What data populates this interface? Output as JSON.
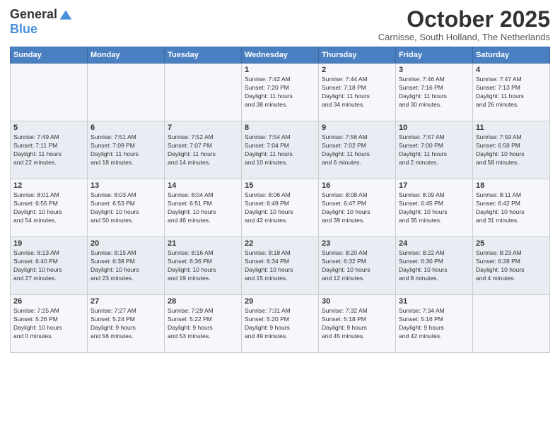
{
  "logo": {
    "general": "General",
    "blue": "Blue"
  },
  "header": {
    "month": "October 2025",
    "location": "Carnisse, South Holland, The Netherlands"
  },
  "weekdays": [
    "Sunday",
    "Monday",
    "Tuesday",
    "Wednesday",
    "Thursday",
    "Friday",
    "Saturday"
  ],
  "weeks": [
    [
      {
        "day": "",
        "info": ""
      },
      {
        "day": "",
        "info": ""
      },
      {
        "day": "",
        "info": ""
      },
      {
        "day": "1",
        "info": "Sunrise: 7:42 AM\nSunset: 7:20 PM\nDaylight: 11 hours\nand 38 minutes."
      },
      {
        "day": "2",
        "info": "Sunrise: 7:44 AM\nSunset: 7:18 PM\nDaylight: 11 hours\nand 34 minutes."
      },
      {
        "day": "3",
        "info": "Sunrise: 7:46 AM\nSunset: 7:16 PM\nDaylight: 11 hours\nand 30 minutes."
      },
      {
        "day": "4",
        "info": "Sunrise: 7:47 AM\nSunset: 7:13 PM\nDaylight: 11 hours\nand 26 minutes."
      }
    ],
    [
      {
        "day": "5",
        "info": "Sunrise: 7:49 AM\nSunset: 7:11 PM\nDaylight: 11 hours\nand 22 minutes."
      },
      {
        "day": "6",
        "info": "Sunrise: 7:51 AM\nSunset: 7:09 PM\nDaylight: 11 hours\nand 18 minutes."
      },
      {
        "day": "7",
        "info": "Sunrise: 7:52 AM\nSunset: 7:07 PM\nDaylight: 11 hours\nand 14 minutes."
      },
      {
        "day": "8",
        "info": "Sunrise: 7:54 AM\nSunset: 7:04 PM\nDaylight: 11 hours\nand 10 minutes."
      },
      {
        "day": "9",
        "info": "Sunrise: 7:56 AM\nSunset: 7:02 PM\nDaylight: 11 hours\nand 6 minutes."
      },
      {
        "day": "10",
        "info": "Sunrise: 7:57 AM\nSunset: 7:00 PM\nDaylight: 11 hours\nand 2 minutes."
      },
      {
        "day": "11",
        "info": "Sunrise: 7:59 AM\nSunset: 6:58 PM\nDaylight: 10 hours\nand 58 minutes."
      }
    ],
    [
      {
        "day": "12",
        "info": "Sunrise: 8:01 AM\nSunset: 6:55 PM\nDaylight: 10 hours\nand 54 minutes."
      },
      {
        "day": "13",
        "info": "Sunrise: 8:03 AM\nSunset: 6:53 PM\nDaylight: 10 hours\nand 50 minutes."
      },
      {
        "day": "14",
        "info": "Sunrise: 8:04 AM\nSunset: 6:51 PM\nDaylight: 10 hours\nand 46 minutes."
      },
      {
        "day": "15",
        "info": "Sunrise: 8:06 AM\nSunset: 6:49 PM\nDaylight: 10 hours\nand 42 minutes."
      },
      {
        "day": "16",
        "info": "Sunrise: 8:08 AM\nSunset: 6:47 PM\nDaylight: 10 hours\nand 39 minutes."
      },
      {
        "day": "17",
        "info": "Sunrise: 8:09 AM\nSunset: 6:45 PM\nDaylight: 10 hours\nand 35 minutes."
      },
      {
        "day": "18",
        "info": "Sunrise: 8:11 AM\nSunset: 6:42 PM\nDaylight: 10 hours\nand 31 minutes."
      }
    ],
    [
      {
        "day": "19",
        "info": "Sunrise: 8:13 AM\nSunset: 6:40 PM\nDaylight: 10 hours\nand 27 minutes."
      },
      {
        "day": "20",
        "info": "Sunrise: 8:15 AM\nSunset: 6:38 PM\nDaylight: 10 hours\nand 23 minutes."
      },
      {
        "day": "21",
        "info": "Sunrise: 8:16 AM\nSunset: 6:36 PM\nDaylight: 10 hours\nand 19 minutes."
      },
      {
        "day": "22",
        "info": "Sunrise: 8:18 AM\nSunset: 6:34 PM\nDaylight: 10 hours\nand 15 minutes."
      },
      {
        "day": "23",
        "info": "Sunrise: 8:20 AM\nSunset: 6:32 PM\nDaylight: 10 hours\nand 12 minutes."
      },
      {
        "day": "24",
        "info": "Sunrise: 8:22 AM\nSunset: 6:30 PM\nDaylight: 10 hours\nand 8 minutes."
      },
      {
        "day": "25",
        "info": "Sunrise: 8:23 AM\nSunset: 6:28 PM\nDaylight: 10 hours\nand 4 minutes."
      }
    ],
    [
      {
        "day": "26",
        "info": "Sunrise: 7:25 AM\nSunset: 5:26 PM\nDaylight: 10 hours\nand 0 minutes."
      },
      {
        "day": "27",
        "info": "Sunrise: 7:27 AM\nSunset: 5:24 PM\nDaylight: 9 hours\nand 56 minutes."
      },
      {
        "day": "28",
        "info": "Sunrise: 7:29 AM\nSunset: 5:22 PM\nDaylight: 9 hours\nand 53 minutes."
      },
      {
        "day": "29",
        "info": "Sunrise: 7:31 AM\nSunset: 5:20 PM\nDaylight: 9 hours\nand 49 minutes."
      },
      {
        "day": "30",
        "info": "Sunrise: 7:32 AM\nSunset: 5:18 PM\nDaylight: 9 hours\nand 45 minutes."
      },
      {
        "day": "31",
        "info": "Sunrise: 7:34 AM\nSunset: 5:16 PM\nDaylight: 9 hours\nand 42 minutes."
      },
      {
        "day": "",
        "info": ""
      }
    ]
  ]
}
